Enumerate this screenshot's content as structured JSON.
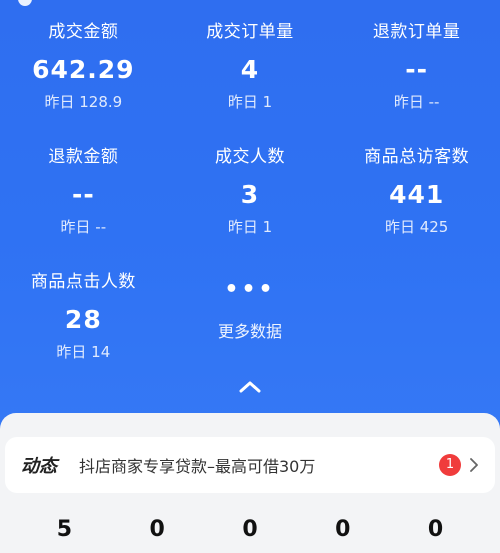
{
  "metrics": [
    {
      "label": "成交金额",
      "value": "642.29",
      "yesterday": "昨日 128.9"
    },
    {
      "label": "成交订单量",
      "value": "4",
      "yesterday": "昨日 1"
    },
    {
      "label": "退款订单量",
      "value": "--",
      "yesterday": "昨日 --"
    },
    {
      "label": "退款金额",
      "value": "--",
      "yesterday": "昨日 --"
    },
    {
      "label": "成交人数",
      "value": "3",
      "yesterday": "昨日 1"
    },
    {
      "label": "商品总访客数",
      "value": "441",
      "yesterday": "昨日 425"
    },
    {
      "label": "商品点击人数",
      "value": "28",
      "yesterday": "昨日 14"
    }
  ],
  "more": {
    "dots": "•••",
    "label": "更多数据"
  },
  "notice": {
    "tag": "动态",
    "text": "抖店商家专享贷款–最高可借30万",
    "badge": "1"
  },
  "bottom_values": [
    "5",
    "0",
    "0",
    "0",
    "0"
  ],
  "colors": {
    "accent": "#2f6ff0",
    "badge": "#f03c3c"
  }
}
